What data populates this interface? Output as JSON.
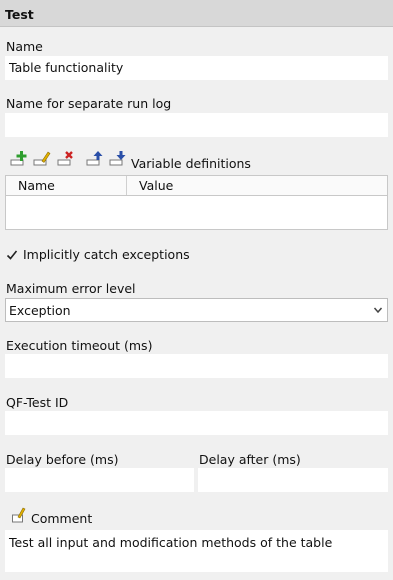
{
  "header": {
    "title": "Test"
  },
  "name": {
    "label": "Name",
    "value": "Table functionality"
  },
  "separate_run_log": {
    "label": "Name for separate run log",
    "value": ""
  },
  "variables": {
    "label": "Variable definitions",
    "columns": [
      "Name",
      "Value"
    ],
    "toolbar_icons": [
      "add-icon",
      "edit-icon",
      "delete-icon",
      "move-up-icon",
      "move-down-icon"
    ],
    "icon_colors": {
      "add": "#2e9e2e",
      "edit": "#e0b000",
      "delete": "#cc2222",
      "arrows": "#2a4fa8"
    }
  },
  "catch_exceptions": {
    "label": "Implicitly catch exceptions",
    "checked": true
  },
  "max_error_level": {
    "label": "Maximum error level",
    "value": "Exception"
  },
  "execution_timeout": {
    "label": "Execution timeout (ms)",
    "value": ""
  },
  "qftest_id": {
    "label": "QF-Test ID",
    "value": ""
  },
  "delay_before": {
    "label": "Delay before (ms)",
    "value": ""
  },
  "delay_after": {
    "label": "Delay after (ms)",
    "value": ""
  },
  "comment": {
    "label": "Comment",
    "value": "Test all input and modification methods of the table"
  }
}
